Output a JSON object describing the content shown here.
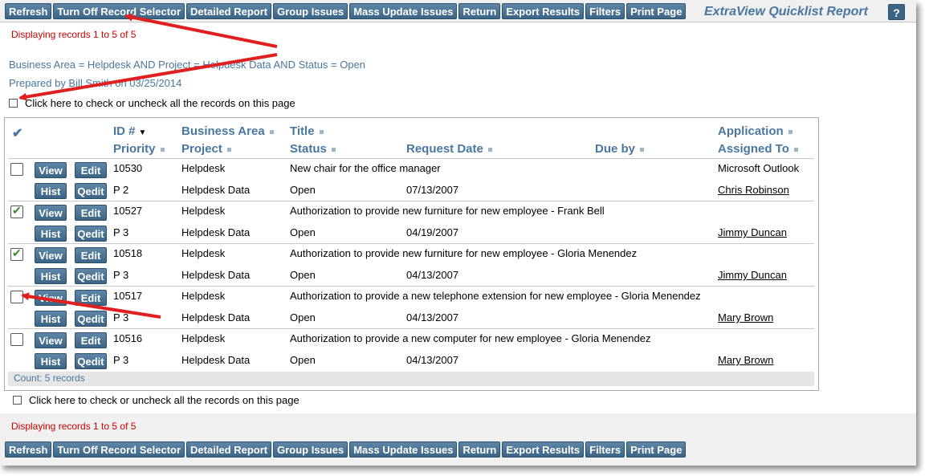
{
  "toolbar": {
    "buttons": [
      "Refresh",
      "Turn Off Record Selector",
      "Detailed Report",
      "Group Issues",
      "Mass Update Issues",
      "Return",
      "Export Results",
      "Filters",
      "Print Page"
    ]
  },
  "header": {
    "app_title": "ExtraView Quicklist Report",
    "help_label": "?"
  },
  "status": {
    "displaying": "Displaying records 1 to 5 of 5"
  },
  "report": {
    "criteria": "Business Area = Helpdesk AND Project = Helpdesk Data AND Status = Open",
    "prepared": "Prepared by Bill Smith on 03/25/2014",
    "check_all_label": "Click here to check or uncheck all the records on this page"
  },
  "columns": {
    "check": "✔",
    "id": "ID #",
    "business_area": "Business Area",
    "title": "Title",
    "application": "Application",
    "priority": "Priority",
    "project": "Project",
    "status": "Status",
    "request_date": "Request Date",
    "due_by": "Due by",
    "assigned_to": "Assigned To"
  },
  "row_buttons": {
    "view": "View",
    "edit": "Edit",
    "hist": "Hist",
    "qedit": "Qedit"
  },
  "rows": [
    {
      "checked": false,
      "id": "10530",
      "business_area": "Helpdesk",
      "title": "New chair for the office manager",
      "application": "Microsoft Outlook",
      "priority": "P 2",
      "project": "Helpdesk Data",
      "status": "Open",
      "request_date": "07/13/2007",
      "assigned_to": "Chris Robinson"
    },
    {
      "checked": true,
      "id": "10527",
      "business_area": "Helpdesk",
      "title": "Authorization to provide new furniture for new employee - Frank Bell",
      "application": "",
      "priority": "P 3",
      "project": "Helpdesk Data",
      "status": "Open",
      "request_date": "04/19/2007",
      "assigned_to": "Jimmy Duncan"
    },
    {
      "checked": true,
      "id": "10518",
      "business_area": "Helpdesk",
      "title": "Authorization to provide new furniture for new employee - Gloria Menendez",
      "application": "",
      "priority": "P 3",
      "project": "Helpdesk Data",
      "status": "Open",
      "request_date": "04/13/2007",
      "assigned_to": "Jimmy Duncan"
    },
    {
      "checked": false,
      "id": "10517",
      "business_area": "Helpdesk",
      "title": "Authorization to provide a new telephone extension for new employee - Gloria Menendez",
      "application": "",
      "priority": "P 3",
      "project": "Helpdesk Data",
      "status": "Open",
      "request_date": "04/13/2007",
      "assigned_to": "Mary Brown"
    },
    {
      "checked": false,
      "id": "10516",
      "business_area": "Helpdesk",
      "title": "Authorization to provide a new computer for new employee - Gloria Menendez",
      "application": "",
      "priority": "P 3",
      "project": "Helpdesk Data",
      "status": "Open",
      "request_date": "04/13/2007",
      "assigned_to": "Mary Brown"
    }
  ],
  "footer": {
    "count": "Count: 5 records"
  },
  "colors": {
    "accent": "#4a77a0",
    "button": "#3c6585",
    "status_red": "#cc0000",
    "arrow": "#e02020"
  }
}
